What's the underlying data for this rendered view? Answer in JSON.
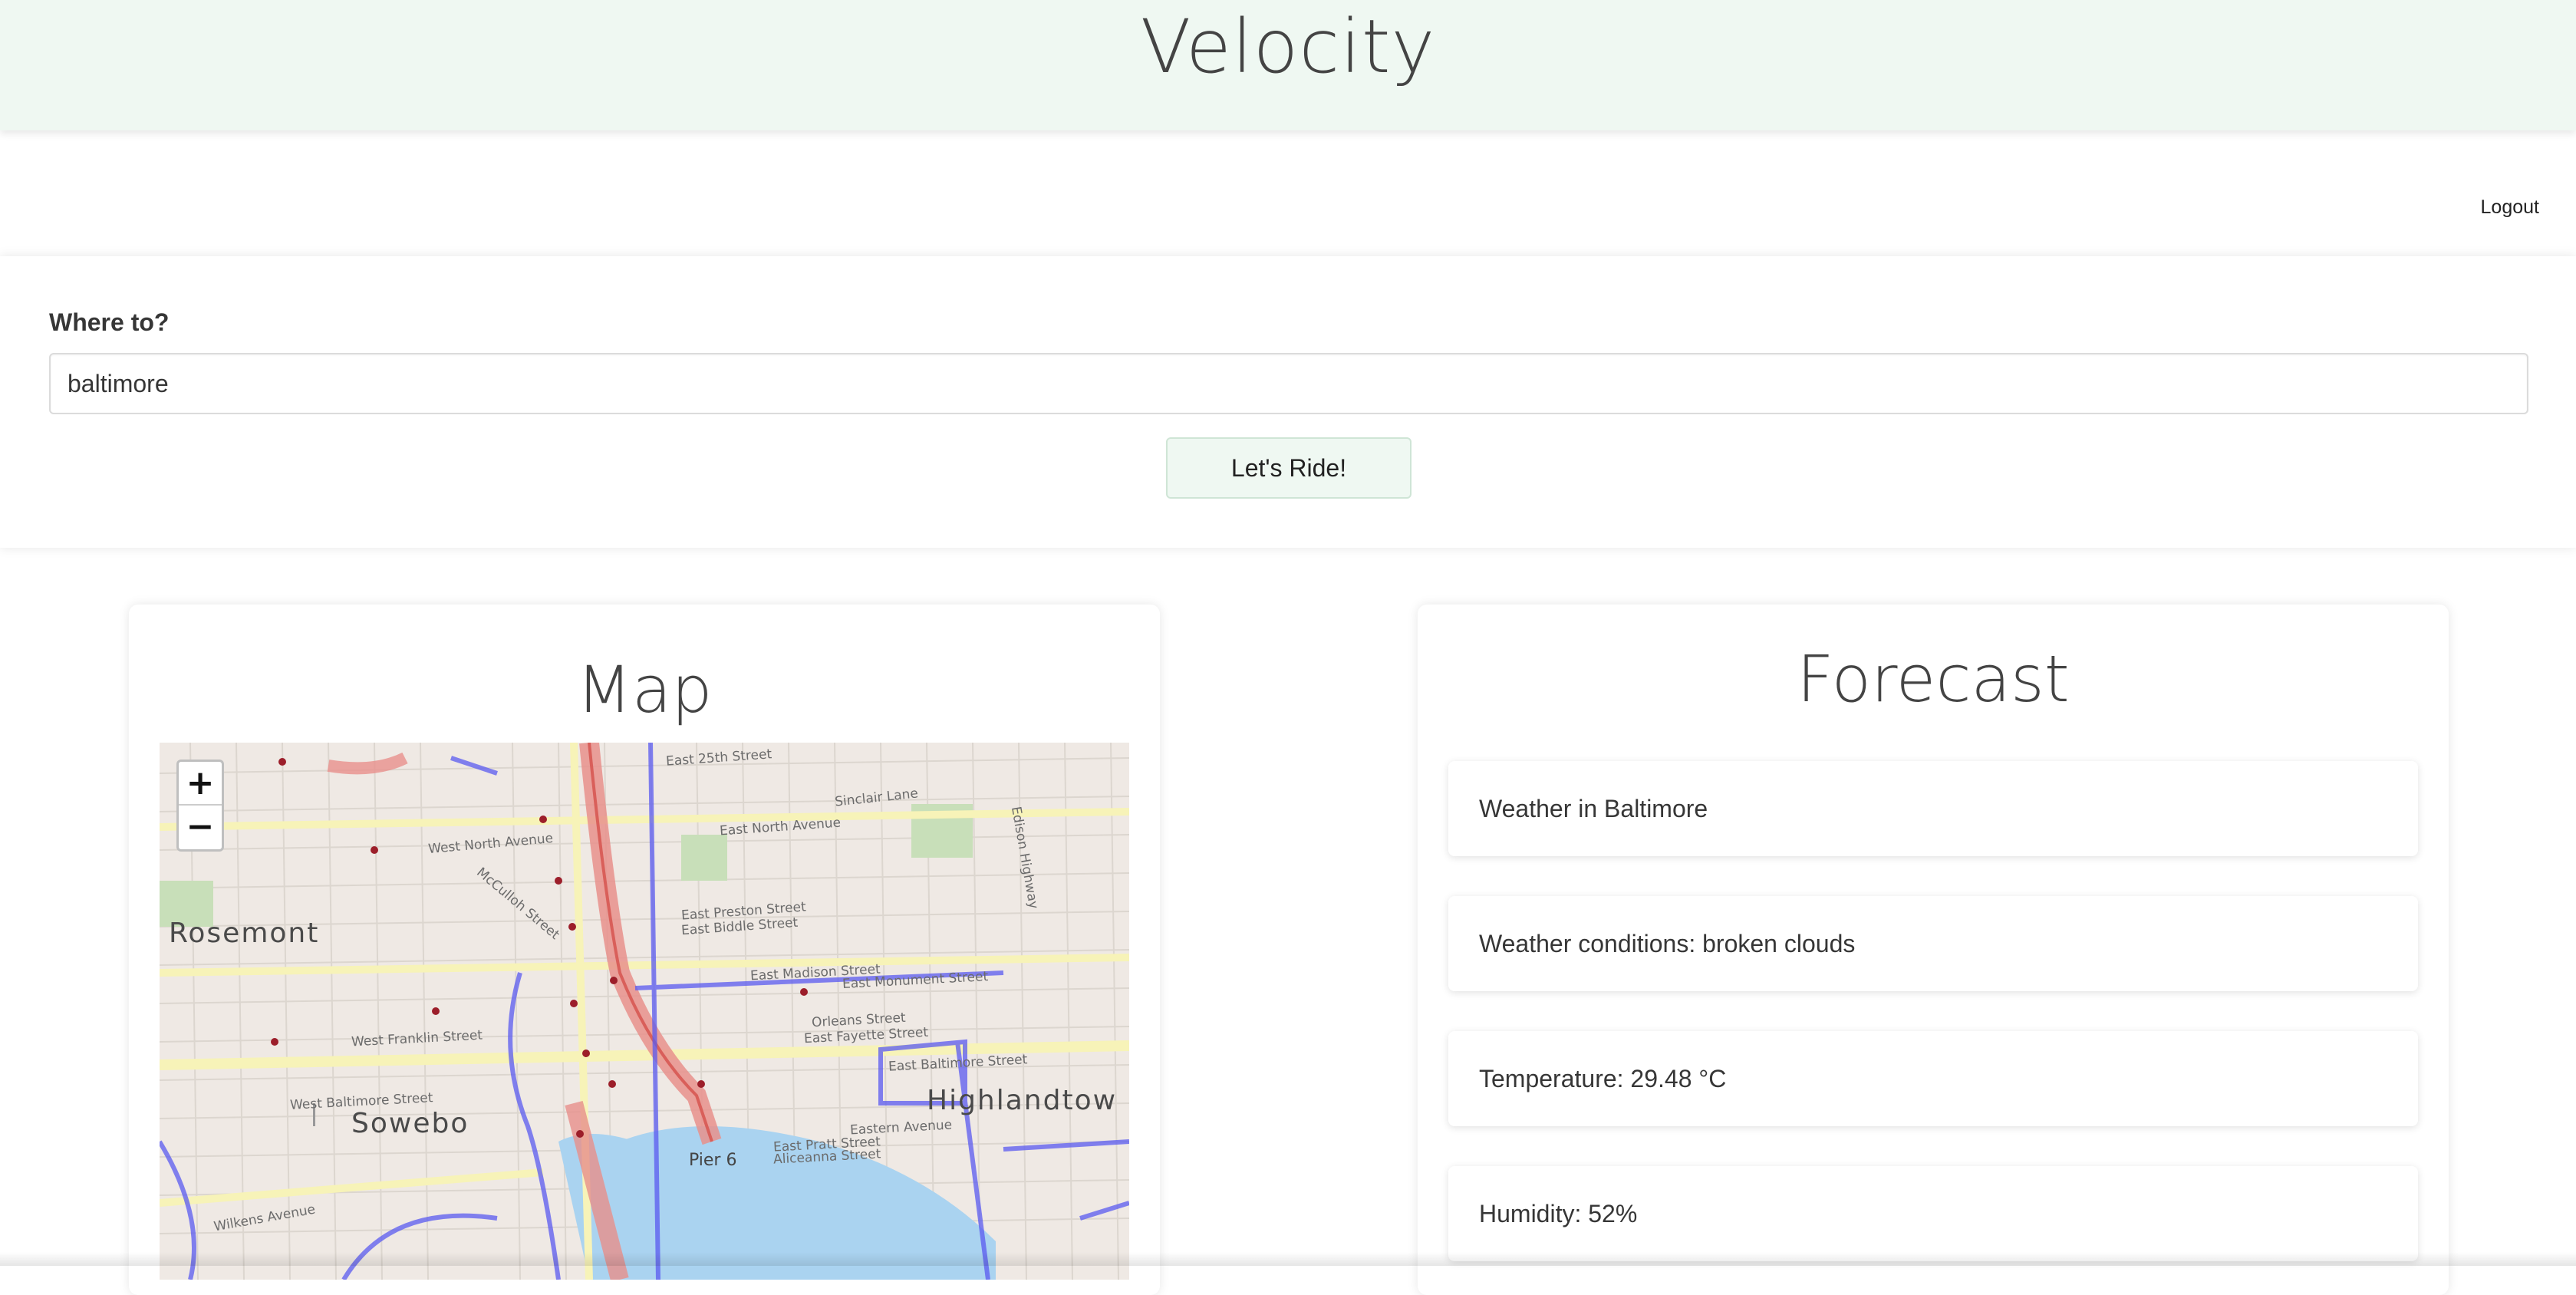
{
  "header": {
    "brand": "Velocity"
  },
  "nav": {
    "logout_label": "Logout"
  },
  "search": {
    "label": "Where to?",
    "value": "baltimore",
    "submit_label": "Let's Ride!"
  },
  "map": {
    "title": "Map",
    "zoom_in": "+",
    "zoom_out": "−",
    "labels": {
      "rosemont": "Rosemont",
      "sowebo": "Sowebo",
      "highlandtown": "Highlandtow",
      "pier6": "Pier 6",
      "east25th": "East 25th Street",
      "westnorth": "West North Avenue",
      "eastnorth": "East North Avenue",
      "mcculloh": "McCulloh Street",
      "eastpreston": "East Preston Street",
      "eastbiddle": "East Biddle Street",
      "eastmadison": "East Madison Street",
      "eastmonument": "East Monument Street",
      "westfranklin": "West Franklin Street",
      "orleans": "Orleans Street",
      "eastfayette": "East Fayette Street",
      "eastbaltimore": "East Baltimore Street",
      "westbaltimore": "West Baltimore Street",
      "eastpratt": "East Pratt Street",
      "aliceanna": "Aliceanna Street",
      "easternavenue": "Eastern Avenue",
      "wilkens": "Wilkens Avenue",
      "sinclair": "Sinclair Lane",
      "edison": "Edison Highway"
    }
  },
  "forecast": {
    "title": "Forecast",
    "items": [
      "Weather in Baltimore",
      "Weather conditions: broken clouds",
      "Temperature: 29.48 °C",
      "Humidity: 52%"
    ]
  },
  "colors": {
    "header_bg": "#eff8f2",
    "button_bg": "#eff8f2",
    "map_land": "#efe9e4",
    "map_water": "#aad3f0",
    "bike_route": "#5a5af0",
    "highway": "#e8908c"
  }
}
